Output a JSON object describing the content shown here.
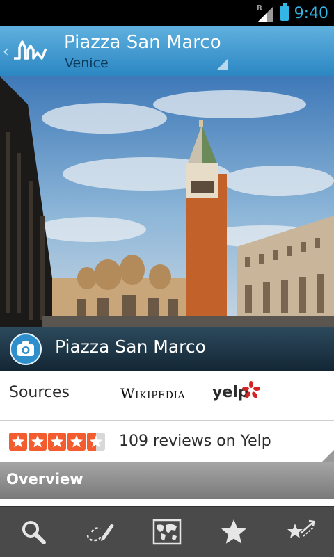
{
  "status_bar": {
    "time": "9:40",
    "signal_label": "R"
  },
  "action_bar": {
    "title": "Piazza San Marco",
    "subtitle": "Venice"
  },
  "photo_caption": {
    "title": "Piazza San Marco"
  },
  "sources": {
    "label": "Sources",
    "wikipedia": "Wikipedia",
    "yelp": "yelp"
  },
  "reviews": {
    "rating_stars": 4.5,
    "text": "109 reviews on Yelp"
  },
  "overview": {
    "label": "Overview"
  },
  "bottom_nav": [
    {
      "id": "search",
      "icon": "search-icon"
    },
    {
      "id": "draw",
      "icon": "route-pencil-icon"
    },
    {
      "id": "map",
      "icon": "world-map-icon"
    },
    {
      "id": "favorites",
      "icon": "star-icon"
    },
    {
      "id": "more",
      "icon": "star-arrow-icon"
    }
  ],
  "colors": {
    "accent": "#33b5e5",
    "action_bar": "#2b86c2",
    "yelp_red": "#f35c2f"
  }
}
